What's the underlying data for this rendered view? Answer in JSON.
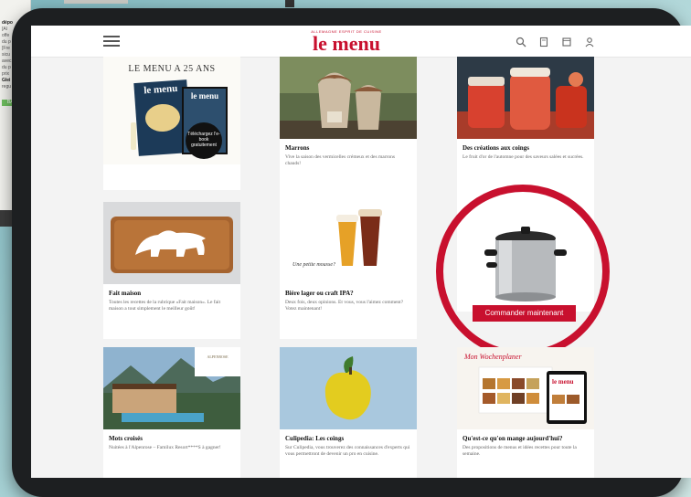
{
  "header": {
    "logo_tagline": "ALLEMAGNE ESPRIT DE CUISINE",
    "logo_text": "le menu"
  },
  "cards": [
    {
      "id": "anniv",
      "title": "",
      "desc": "",
      "banner": "LE MENU A 25 ANS",
      "magazine": "le menu",
      "sticker": "Téléchargez l'e-book gratuitement"
    },
    {
      "id": "marrons",
      "title": "Marrons",
      "desc": "Vive la saison des vermicelles crémeux et des marrons chauds!"
    },
    {
      "id": "coings",
      "title": "Des créations aux coings",
      "desc": "Le fruit d'or de l'automne pour des saveurs salées et sucrées."
    },
    {
      "id": "fait-maison",
      "title": "Fait maison",
      "desc": "Toutes les recettes de la rubrique «Fait maison». Le fait maison a tout simplement le meilleur goût!"
    },
    {
      "id": "biere",
      "title": "Bière lager ou craft IPA?",
      "desc": "Deux fois, deux opinions. Et vous, vous l'aimez comment? Votez maintenant!",
      "handwriting": "Une petite mousse?"
    },
    {
      "id": "mots-croises",
      "title": "Mots croisés",
      "desc": "Nuitées à l'Alpenrose – Familux Resort****S à gagner!",
      "hotel_sign": "ALPENROSE"
    },
    {
      "id": "culipedia",
      "title": "Culipedia: Les coings",
      "desc": "Sur Culipedia, vous trouverez des connaissances d'experts qui vous permettront de devenir un pro en cuisine."
    },
    {
      "id": "menu-jour",
      "title": "Qu'est-ce qu'on mange aujourd'hui?",
      "desc": "Des propositions de menus et idées recettes pour toute la semaine.",
      "planner": "Mon Wochenplaner",
      "logo": "le menu"
    }
  ],
  "promo": {
    "cta_label": "Commander maintenant"
  },
  "background_page": {
    "lines": [
      "dépo",
      "",
      "[Al",
      "offe",
      "du p",
      "",
      "[Fre",
      "sicu",
      "avec",
      "du p",
      "prix",
      "",
      "Glei",
      "regu"
    ],
    "tag": "BAR"
  },
  "colors": {
    "brand_red": "#c8102e",
    "frame": "#1d1f21"
  }
}
